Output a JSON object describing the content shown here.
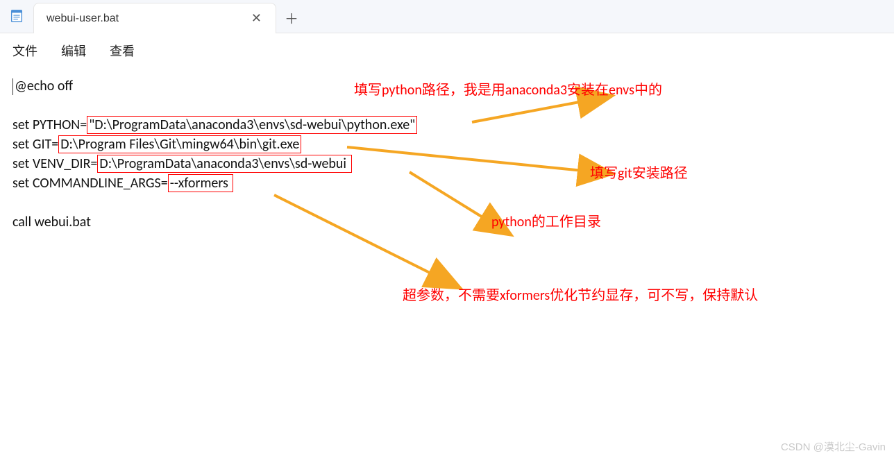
{
  "tab": {
    "title": "webui-user.bat"
  },
  "menu": {
    "file": "文件",
    "edit": "编辑",
    "view": "查看"
  },
  "code": {
    "l1": "@echo off",
    "l2_prefix": "set PYTHON=",
    "l2_hl": "\"D:\\ProgramData\\anaconda3\\envs\\sd-webui\\python.exe\"",
    "l3_prefix": "set GIT=",
    "l3_hl": "D:\\Program Files\\Git\\mingw64\\bin\\git.exe",
    "l4_prefix": "set VENV_DIR=",
    "l4_hl": "D:\\ProgramData\\anaconda3\\envs\\sd-webui ",
    "l5_prefix": "set COMMANDLINE_ARGS=",
    "l5_hl": "--xformers ",
    "l6": "call webui.bat"
  },
  "annotations": {
    "a1": "填写python路径，我是用anaconda3安装在envs中的",
    "a2": "填写git安装路径",
    "a3": "python的工作目录",
    "a4": "超参数，不需要xformers优化节约显存，可不写，保持默认"
  },
  "watermark": "CSDN @漠北尘-Gavin"
}
